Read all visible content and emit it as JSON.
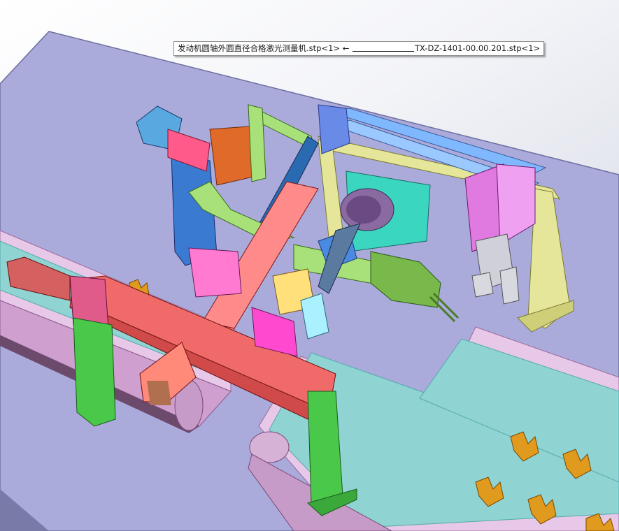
{
  "tooltip": {
    "assembly_path": "发动机圆轴外圆直径合格激光测量机.stp<1>",
    "arrow": "←",
    "part_path": "TX-DZ-1401-00.00.201.stp<1>"
  }
}
